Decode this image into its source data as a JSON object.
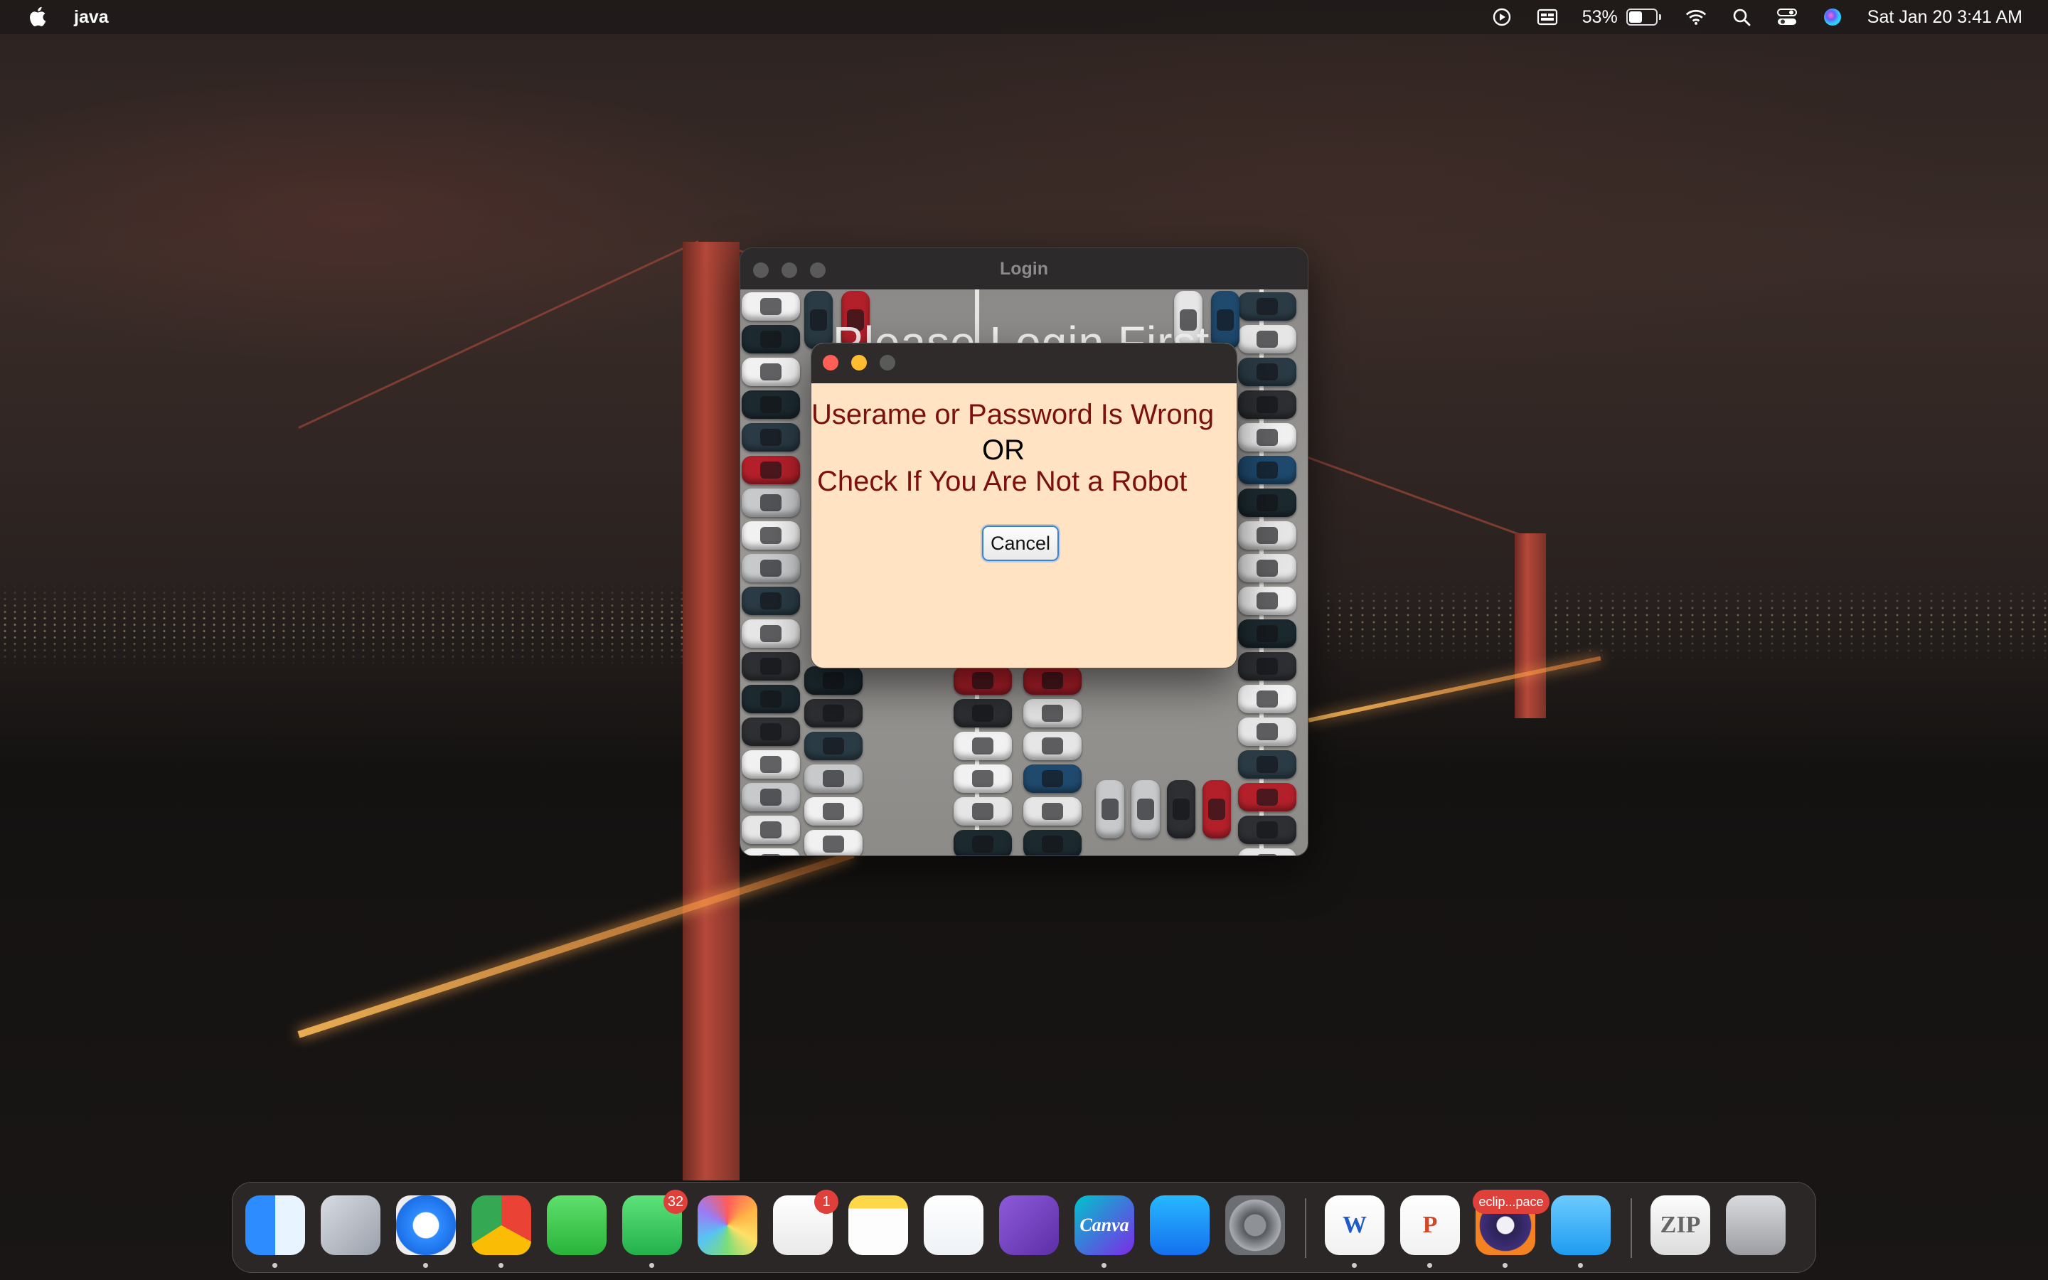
{
  "menubar": {
    "app_name": "java",
    "battery_percent": "53%",
    "battery_level": 0.53,
    "datetime": "Sat Jan 20  3:41 AM",
    "icons": [
      "apple-icon",
      "play-circle-icon",
      "display-icon",
      "battery-icon",
      "wifi-icon",
      "search-icon",
      "control-center-icon",
      "siri-icon"
    ]
  },
  "login_window": {
    "title": "Login",
    "background_title": "Please Login First"
  },
  "error_dialog": {
    "line1": "Userame or Password Is Wrong",
    "line2": "OR",
    "line3": "Check If You Are Not a Robot",
    "cancel_label": "Cancel"
  },
  "dock": {
    "items": [
      {
        "name": "Finder",
        "icon": "finder-icon",
        "running": true
      },
      {
        "name": "Launchpad",
        "icon": "launchpad-icon",
        "running": false
      },
      {
        "name": "Safari",
        "icon": "safari-icon",
        "running": true
      },
      {
        "name": "Chrome",
        "icon": "chrome-icon",
        "running": true
      },
      {
        "name": "FaceTime",
        "icon": "facetime-icon",
        "running": false
      },
      {
        "name": "WhatsApp",
        "icon": "whatsapp-icon",
        "running": true,
        "badge": "32"
      },
      {
        "name": "Photos",
        "icon": "photos-icon",
        "running": false
      },
      {
        "name": "Reminders",
        "icon": "reminders-icon",
        "running": false,
        "badge": "1"
      },
      {
        "name": "Notes",
        "icon": "notes-icon",
        "running": false
      },
      {
        "name": "Visual Studio Code",
        "icon": "vscode-icon",
        "running": false
      },
      {
        "name": "Visual Studio",
        "icon": "visual-studio-icon",
        "running": false
      },
      {
        "name": "Canva",
        "icon": "canva-icon",
        "running": true,
        "label": "Canva"
      },
      {
        "name": "App Store",
        "icon": "app-store-icon",
        "running": false
      },
      {
        "name": "System Settings",
        "icon": "system-settings-icon",
        "running": false
      },
      {
        "name": "Word",
        "icon": "word-icon",
        "running": true,
        "label": "W"
      },
      {
        "name": "PowerPoint",
        "icon": "powerpoint-icon",
        "running": true,
        "label": "P"
      },
      {
        "name": "Eclipse",
        "icon": "eclipse-icon",
        "running": true,
        "badge": "eclip...pace"
      },
      {
        "name": "Folder",
        "icon": "folder-icon",
        "running": true
      },
      {
        "name": "Zip Archive",
        "icon": "zip-icon",
        "running": false,
        "label": "ZIP"
      },
      {
        "name": "Trash",
        "icon": "trash-icon",
        "running": false
      }
    ]
  },
  "colors": {
    "dialog_bg": "#ffe3c3",
    "error_text": "#7c0f0f",
    "close": "#ff5f57",
    "minimize": "#febc2e",
    "inactive": "#5a5a5a",
    "focus_ring": "#3b82d6"
  }
}
